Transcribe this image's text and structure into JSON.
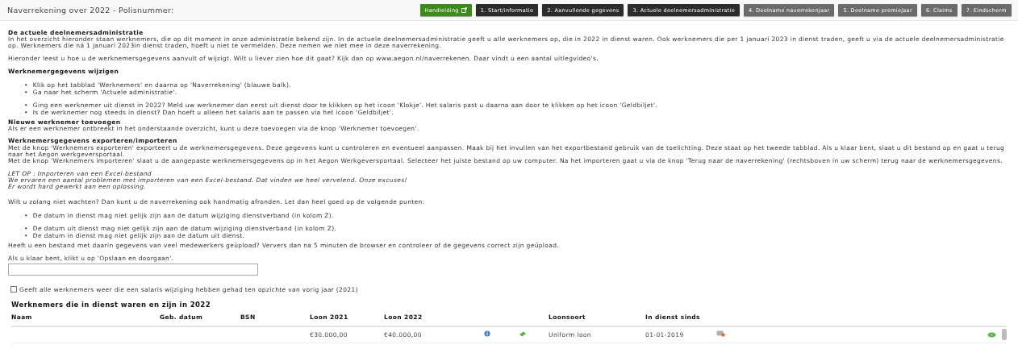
{
  "header": {
    "title": "Naverrekening over 2022 - Polisnummer:",
    "steps": [
      {
        "label": "Handleiding",
        "kind": "manual"
      },
      {
        "label": "1. Start/informatie",
        "kind": "done"
      },
      {
        "label": "2. Aanvullende gegevens",
        "kind": "done"
      },
      {
        "label": "3. Actuele deelnemersadministratie",
        "kind": "done"
      },
      {
        "label": "4. Deelname naverrekenjaar",
        "kind": "todo"
      },
      {
        "label": "5. Deelname premiejaar",
        "kind": "todo"
      },
      {
        "label": "6. Claims",
        "kind": "todo"
      },
      {
        "label": "7. Eindscherm",
        "kind": "todo"
      }
    ]
  },
  "content": [
    {
      "kind": "text",
      "heading": "De actuele deelnemersadministratie",
      "lines": [
        "In het overzicht hieronder staan werknemers, die op dit moment in onze administratie bekend zijn. In de actuele deelnemersadministratie geeft u alle werknemers op, die in 2022 in dienst waren. Ook werknemers die per 1 januari 2023 in dienst traden, geeft u via de actuele deelnemersadministratie op. Werknemers die ná 1 januari 2023in dienst traden, hoeft u niet te vermelden. Deze nemen we niet mee in deze naverrekening."
      ]
    },
    {
      "kind": "text",
      "lines": [
        "Hieronder leest u hoe u de werknemersgegevens aanvult of wijzigt. Wilt u liever zien hoe dit gaat? Kijk dan op www.aegon.nl/naverrekenen. Daar vindt u een aantal uitlegvideo's."
      ]
    },
    {
      "kind": "text",
      "heading": "Werknemergegevens wijzigen"
    },
    {
      "kind": "list",
      "marker": "•",
      "groups": [
        [
          "Klik op het tabblad 'Werknemers' en daarna op 'Naverrekening' (blauwe balk).",
          "Ga naar het scherm 'Actuele administratie'."
        ],
        [
          "Ging een werknemer uit dienst in 2022? Meld uw werknemer dan eerst uit dienst door te klikken op het icoon 'Klokje'. Het salaris past u daarna aan door te klikken op het icoon 'Geldbiljet'.",
          "Is de werknemer nog steeds in dienst? Dan hoeft u alleen het salaris aan te passen via het icoon 'Geldbiljet'."
        ]
      ]
    },
    {
      "kind": "text",
      "heading": "Nieuwe werknemer toevoegen",
      "lines": [
        "Als er een werknemer ontbreekt in het onderstaande overzicht, kunt u deze toevoegen via de knop 'Werknemer toevoegen'."
      ]
    },
    {
      "kind": "text",
      "heading": "Werknemersgegevens exporteren/importeren",
      "lines": [
        "Met de knop 'Werknemers exporteren' exporteert u de werknemersgegevens. Deze gegevens kunt u controleren en eventueel aanpassen. Maak bij het invullen van het exportbestand gebruik van de toelichting. Deze staat op het tweede tabblad. Als u klaar bent, slaat u dit bestand op en gaat u terug naar het Aegon werkgeversportaal.",
        "Met de knop 'Werknemers importeren' slaat u de aangepaste werknemersgegevens op in het Aegon Werkgeversportaal. Selecteer het juiste bestand op uw computer. Na het importeren gaat u via de knop 'Terug naar de naverrekening' (rechtsboven in uw scherm) terug naar de werknemersgegevens."
      ]
    },
    {
      "kind": "note",
      "lines": [
        "LET OP : Importeren van een Excel-bestand",
        "We ervaren een aantal problemen met importeren van een Excel-bestand. Dat vinden we heel vervelend. Onze excuses!",
        "Er wordt hard gewerkt aan een oplossing."
      ]
    },
    {
      "kind": "text",
      "lines": [
        "Wilt u zolang niet wachten? Dan kunt u de naverrekening ook handmatig afronden. Let dan heel goed op de volgende punten:"
      ]
    },
    {
      "kind": "list",
      "marker": "•",
      "groups": [
        [
          "De datum in dienst mag niet gelijk zijn aan de datum wijziging dienstverband (in kolom Z)."
        ],
        [
          "De datum uit dienst mag niet gelijk zijn aan de datum wijziging dienstverband (in kolom Z).",
          "De datum in dienst mag niet gelijk zijn aan de datum uit dienst."
        ]
      ]
    },
    {
      "kind": "text",
      "lines": [
        "Heeft u een bestand met daarin gegevens van veel medewerkers geüpload? Ververs dan na 5 minuten de browser en controleer of de gegevens correct zijn geüpload."
      ]
    },
    {
      "kind": "tight",
      "lines": [
        "Als u klaar bent, klikt u op 'Opslaan en doorgaan'."
      ]
    }
  ],
  "checkbox": {
    "label": "Geeft alle werknemers weer die een salaris wijziging hebben gehad ten opzichte van vorig jaar (2021)",
    "checked": false
  },
  "table": {
    "title": "Werknemers die in dienst waren en zijn in 2022",
    "columns": [
      "Naam",
      "Geb. datum",
      "BSN",
      "Loon 2021",
      "Loon 2022",
      "Loonsoort",
      "In dienst sinds"
    ],
    "rows": [
      {
        "cells": [
          null,
          null,
          null,
          "€30.000,00",
          "€40.000,00",
          "Uniform loon",
          "01-01-2019"
        ]
      }
    ]
  }
}
